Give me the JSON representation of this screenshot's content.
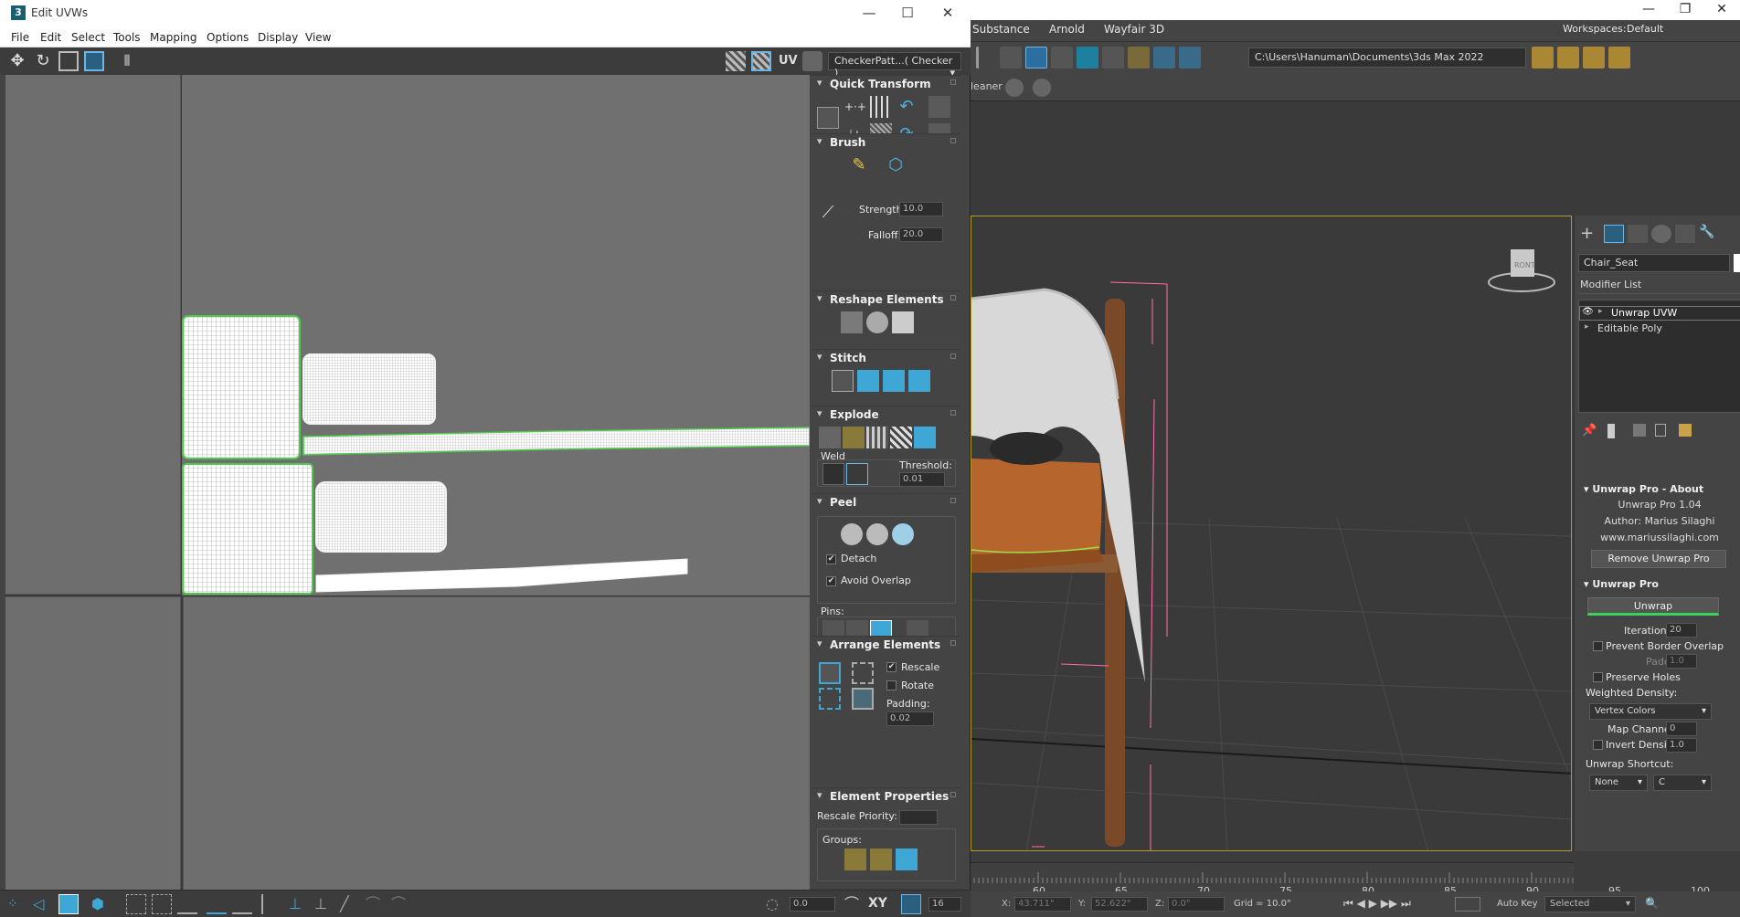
{
  "uvw_window": {
    "title": "Edit UVWs",
    "logo": "3",
    "menu": [
      "File",
      "Edit",
      "Select",
      "Tools",
      "Mapping",
      "Options",
      "Display",
      "View"
    ],
    "uv_label": "UV",
    "texture_dropdown": "CheckerPatt...( Checker )",
    "panel": {
      "quick_transform": "Quick Transform",
      "brush": "Brush",
      "strength_label": "Strength:",
      "strength": "10.0",
      "falloff_label": "Falloff:",
      "falloff": "20.0",
      "reshape": "Reshape Elements",
      "stitch": "Stitch",
      "explode": "Explode",
      "weld": "Weld",
      "threshold_label": "Threshold:",
      "threshold": "0.01",
      "peel": "Peel",
      "detach": "Detach",
      "avoid_overlap": "Avoid Overlap",
      "pins": "Pins:",
      "arrange": "Arrange Elements",
      "rescale": "Rescale",
      "rotate": "Rotate",
      "padding_label": "Padding:",
      "padding": "0.02",
      "element_props": "Element Properties",
      "rescale_priority": "Rescale Priority:",
      "groups": "Groups:"
    },
    "bottom": {
      "value1": "0.0",
      "xy": "XY",
      "value2": "16"
    }
  },
  "max_window": {
    "menu": [
      "Substance",
      "Arnold",
      "Wayfair 3D"
    ],
    "workspaces_label": "Workspaces:",
    "workspaces_value": "Default",
    "path": "C:\\Users\\Hanuman\\Documents\\3ds Max 2022",
    "cleaner": "leaner",
    "object_name": "Chair_Seat",
    "modifier_list": "Modifier List",
    "stack": [
      "Unwrap UVW",
      "Editable Poly"
    ],
    "about_head": "Unwrap Pro - About",
    "about_version": "Unwrap Pro 1.04",
    "about_author": "Author: Marius Silaghi",
    "about_site": "www.mariussilaghi.com",
    "remove_btn": "Remove Unwrap Pro",
    "unwrap_head": "Unwrap Pro",
    "unwrap_btn": "Unwrap",
    "iterations_label": "Iterations:",
    "iterations": "20",
    "prevent_border": "Prevent Border Overlap",
    "padding_label": "Padding:",
    "padding": "1.0",
    "preserve_holes": "Preserve Holes",
    "weighted_density": "Weighted Density:",
    "vertex_colors": "Vertex Colors",
    "map_channel_label": "Map Channel:",
    "map_channel": "0",
    "invert_density_label": "Invert Density:",
    "invert_density": "1.0",
    "shortcut_label": "Unwrap Shortcut:",
    "shortcut_mod": "None",
    "shortcut_key": "C",
    "timeline_ticks": [
      "60",
      "65",
      "70",
      "75",
      "80",
      "85",
      "90",
      "95",
      "100"
    ],
    "status": {
      "x": "X:",
      "y": "Y:",
      "z": "Z:",
      "x_val": "43.711\"",
      "y_val": "52.622\"",
      "z_val": "0.0\"",
      "grid": "Grid = 10.0\"",
      "autokey": "Auto Key",
      "selected": "Selected"
    }
  },
  "colors": {
    "uv_border": "#4ec94e",
    "accent": "#1f9fcf",
    "viewport_frame": "#b39a2a"
  }
}
